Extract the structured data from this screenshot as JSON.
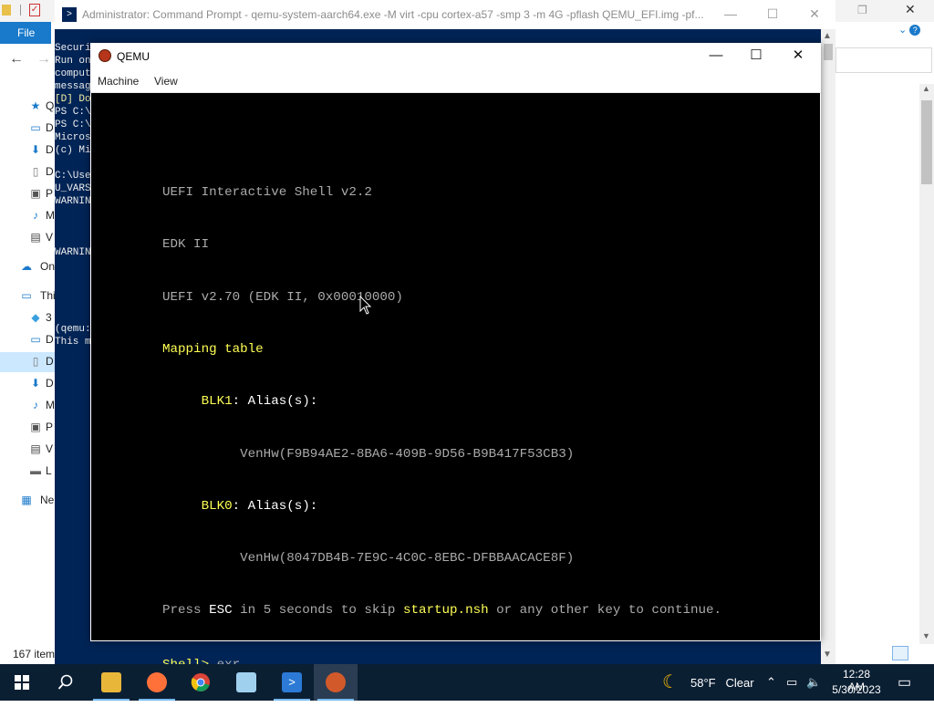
{
  "explorer": {
    "file_tab": "File",
    "nav_items": [
      {
        "label": "Qu",
        "icon": "star-icon"
      },
      {
        "label": "D",
        "icon": "desktop-icon"
      },
      {
        "label": "D",
        "icon": "download-icon"
      },
      {
        "label": "D",
        "icon": "document-icon"
      },
      {
        "label": "P",
        "icon": "picture-icon"
      },
      {
        "label": "M",
        "icon": "music-icon"
      },
      {
        "label": "V",
        "icon": "video-icon"
      },
      {
        "label": "On",
        "icon": "cloud-icon"
      },
      {
        "label": "Thi",
        "icon": "pc-icon"
      },
      {
        "label": "3",
        "icon": "cube-icon"
      },
      {
        "label": "D",
        "icon": "desktop-icon"
      },
      {
        "label": "D",
        "icon": "document-icon"
      },
      {
        "label": "D",
        "icon": "download-icon"
      },
      {
        "label": "M",
        "icon": "music-icon"
      },
      {
        "label": "P",
        "icon": "picture-icon"
      },
      {
        "label": "V",
        "icon": "video-icon"
      },
      {
        "label": "L",
        "icon": "disk-icon"
      },
      {
        "label": "Ne",
        "icon": "network-icon"
      }
    ],
    "status_count": "167 item"
  },
  "cmd": {
    "title": "Administrator:  Command Prompt - qemu-system-aarch64.exe  -M virt -cpu cortex-a57 -smp 3 -m 4G -pflash QEMU_EFI.img -pf...",
    "lines": [
      {
        "text": "Securi",
        "color": "w"
      },
      {
        "text": "Run on",
        "color": "w"
      },
      {
        "text": "comput",
        "color": "w"
      },
      {
        "text": "messag",
        "color": "w"
      },
      {
        "text": "[D] Do",
        "color": "y"
      },
      {
        "text": "PS C:\\",
        "color": "w"
      },
      {
        "text": "PS C:\\",
        "color": "w"
      },
      {
        "text": "Micros",
        "color": "w"
      },
      {
        "text": "(c) Mi",
        "color": "w"
      },
      {
        "text": "",
        "color": "w"
      },
      {
        "text": "C:\\Use",
        "color": "w"
      },
      {
        "text": "U_VARS",
        "color": "w"
      },
      {
        "text": "WARNIN",
        "color": "w"
      },
      {
        "text": "",
        "color": "w"
      },
      {
        "text": "",
        "color": "w"
      },
      {
        "text": "",
        "color": "w"
      },
      {
        "text": "WARNIN",
        "color": "w"
      },
      {
        "text": "",
        "color": "w"
      },
      {
        "text": "",
        "color": "w"
      },
      {
        "text": "",
        "color": "w"
      },
      {
        "text": "",
        "color": "w"
      },
      {
        "text": "",
        "color": "w"
      },
      {
        "text": "(qemu:",
        "color": "w"
      },
      {
        "text": "This m",
        "color": "w"
      }
    ]
  },
  "qemu": {
    "title": "QEMU",
    "menu": [
      "Machine",
      "View"
    ],
    "shell": {
      "line1": "UEFI Interactive Shell v2.2",
      "line2": "EDK II",
      "line3": "UEFI v2.70 (EDK II, 0x00010000)",
      "line4": "Mapping table",
      "blk1_name": "BLK1",
      "blk1_rest": ": Alias(s):",
      "blk1_dev": "VenHw(F9B94AE2-8BA6-409B-9D56-B9B417F53CB3)",
      "blk0_name": "BLK0",
      "blk0_rest": ": Alias(s):",
      "blk0_dev": "VenHw(8047DB4B-7E9C-4C0C-8EBC-DFBBAACACE8F)",
      "press_a": "Press ",
      "press_esc": "ESC",
      "press_b": " in 5 seconds to skip ",
      "press_nsh": "startup.nsh",
      "press_c": " or any other key to continue.",
      "prompt": "Shell> ",
      "typed": "exr"
    }
  },
  "taskbar": {
    "weather_temp": "58°F",
    "weather_cond": "Clear",
    "time": "12:28 AM",
    "date": "5/30/2023"
  },
  "colors": {
    "taskbar": "#0b1f33",
    "shell_yellow": "#ffff55",
    "shell_gray": "#aaaaaa",
    "powershell_blue": "#012456"
  }
}
